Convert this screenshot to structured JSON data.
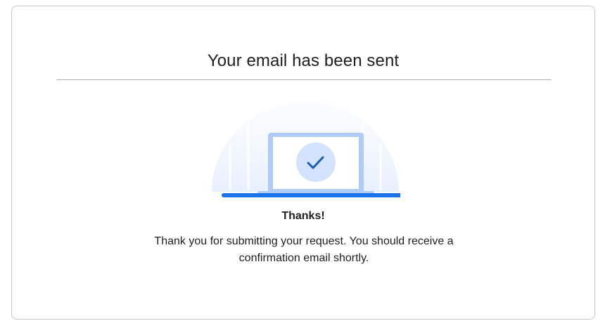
{
  "card": {
    "title": "Your email has been sent",
    "thanks_heading": "Thanks!",
    "message": "Thank you for submitting your request. You should receive a confirmation email shortly."
  },
  "illustration": {
    "icon": "checkmark-icon",
    "accent_color": "#1a73e8",
    "check_color": "#1a5fb4",
    "circle_color": "#d3e3fd",
    "laptop_frame_color": "#aecbfa"
  }
}
